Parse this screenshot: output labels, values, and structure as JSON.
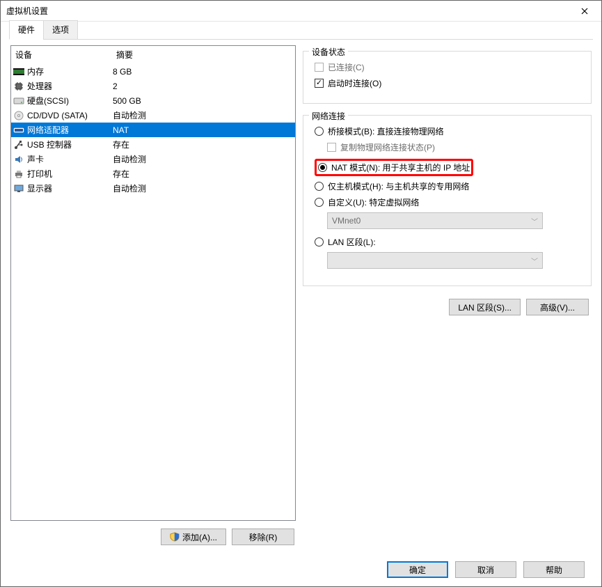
{
  "window": {
    "title": "虚拟机设置"
  },
  "tabs": {
    "hardware": "硬件",
    "options": "选项",
    "active": "hardware"
  },
  "list": {
    "header_device": "设备",
    "header_summary": "摘要",
    "rows": [
      {
        "id": "memory",
        "label": "内存",
        "summary": "8 GB"
      },
      {
        "id": "cpu",
        "label": "处理器",
        "summary": "2"
      },
      {
        "id": "disk",
        "label": "硬盘(SCSI)",
        "summary": "500 GB"
      },
      {
        "id": "cd",
        "label": "CD/DVD (SATA)",
        "summary": "自动检测"
      },
      {
        "id": "net",
        "label": "网络适配器",
        "summary": "NAT",
        "selected": true
      },
      {
        "id": "usb",
        "label": "USB 控制器",
        "summary": "存在"
      },
      {
        "id": "sound",
        "label": "声卡",
        "summary": "自动检测"
      },
      {
        "id": "printer",
        "label": "打印机",
        "summary": "存在"
      },
      {
        "id": "display",
        "label": "显示器",
        "summary": "自动检测"
      }
    ]
  },
  "left_buttons": {
    "add": "添加(A)...",
    "remove": "移除(R)"
  },
  "status_group": {
    "legend": "设备状态",
    "connected": "已连接(C)",
    "connected_checked": false,
    "connected_enabled": false,
    "connect_at_power_on": "启动时连接(O)",
    "connect_at_power_on_checked": true
  },
  "net_group": {
    "legend": "网络连接",
    "bridge": "桥接模式(B): 直接连接物理网络",
    "replicate": "复制物理网络连接状态(P)",
    "replicate_enabled": false,
    "nat": "NAT 模式(N): 用于共享主机的 IP 地址",
    "hostonly": "仅主机模式(H): 与主机共享的专用网络",
    "custom": "自定义(U): 特定虚拟网络",
    "custom_value": "VMnet0",
    "lan": "LAN 区段(L):",
    "lan_value": "",
    "selected": "nat"
  },
  "net_buttons": {
    "lan_seg": "LAN 区段(S)...",
    "advanced": "高级(V)..."
  },
  "footer": {
    "ok": "确定",
    "cancel": "取消",
    "help": "帮助"
  }
}
